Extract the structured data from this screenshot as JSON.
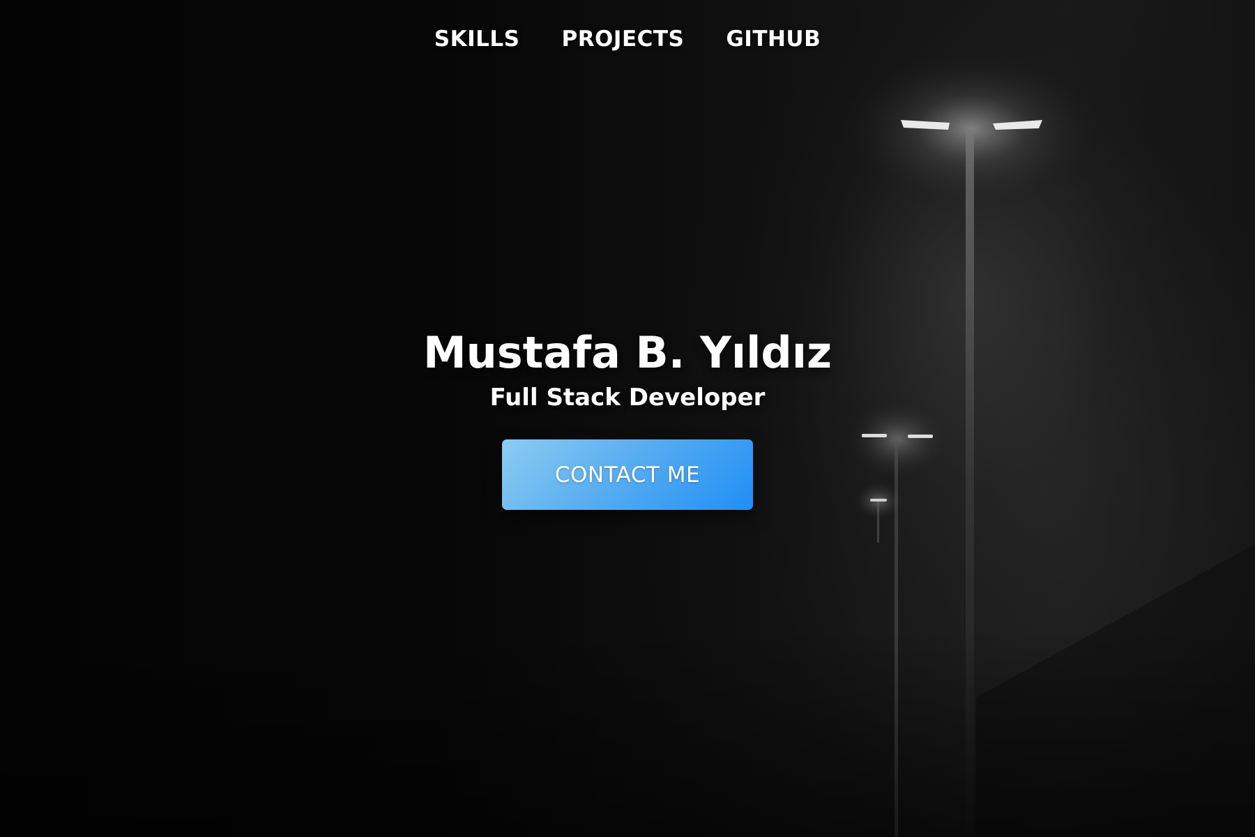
{
  "nav": {
    "items": [
      {
        "label": "SKILLS"
      },
      {
        "label": "PROJECTS"
      },
      {
        "label": "GITHUB"
      }
    ]
  },
  "hero": {
    "name": "Mustafa B. Yıldız",
    "role": "Full Stack Developer",
    "cta_label": "CONTACT ME"
  },
  "colors": {
    "background": "#050505",
    "text": "#ffffff",
    "button_gradient_start": "#8ccdf2",
    "button_gradient_end": "#1f8ff5"
  }
}
